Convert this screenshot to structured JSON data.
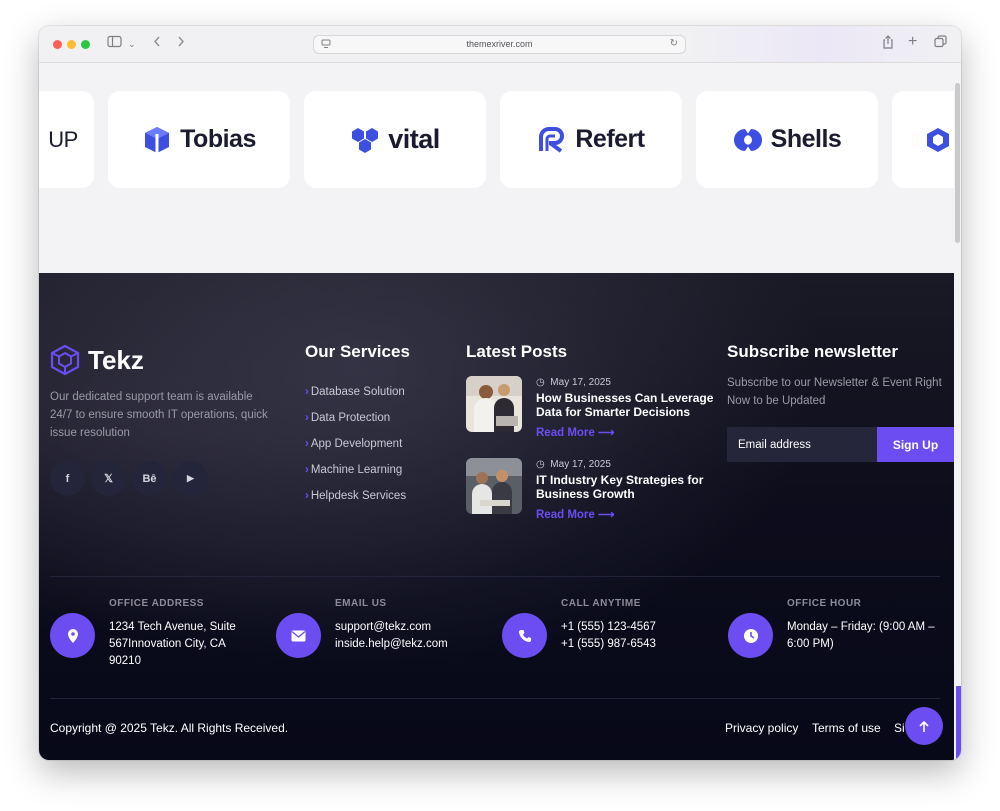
{
  "browser": {
    "url": "themexriver.com"
  },
  "logos": [
    {
      "name": "UP"
    },
    {
      "name": "Tobias"
    },
    {
      "name": "vital"
    },
    {
      "name": "Refert"
    },
    {
      "name": "Shells"
    }
  ],
  "footer": {
    "brand": {
      "name": "Tekz",
      "description": "Our dedicated support team is available 24/7 to ensure smooth IT operations, quick issue resolution"
    },
    "socials": [
      {
        "icon": "facebook-icon",
        "glyph": "f"
      },
      {
        "icon": "x-icon",
        "glyph": "𝕏"
      },
      {
        "icon": "behance-icon",
        "glyph": "Bē"
      },
      {
        "icon": "youtube-icon",
        "glyph": "▶"
      }
    ],
    "services": {
      "title": "Our Services",
      "items": [
        "Database Solution",
        "Data Protection",
        "App Development",
        "Machine Learning",
        "Helpdesk Services"
      ]
    },
    "posts": {
      "title": "Latest Posts",
      "items": [
        {
          "date": "May 17, 2025",
          "title": "How Businesses Can Leverage Data for Smarter Decisions",
          "more": "Read More"
        },
        {
          "date": "May 17, 2025",
          "title": "IT Industry Key Strategies for Business Growth",
          "more": "Read More"
        }
      ]
    },
    "newsletter": {
      "title": "Subscribe newsletter",
      "description": "Subscribe to our Newsletter & Event Right Now to be Updated",
      "placeholder": "Email address",
      "button": "Sign Up"
    },
    "contacts": [
      {
        "label": "OFFICE ADDRESS",
        "icon": "location-pin-icon",
        "lines": [
          "1234 Tech Avenue, Suite",
          "567Innovation City, CA",
          "90210"
        ]
      },
      {
        "label": "EMAIL US",
        "icon": "envelope-icon",
        "lines": [
          "support@tekz.com",
          "inside.help@tekz.com"
        ]
      },
      {
        "label": "CALL ANYTIME",
        "icon": "phone-icon",
        "lines": [
          "+1 (555) 123-4567",
          "+1 (555) 987-6543"
        ]
      },
      {
        "label": "OFFICE HOUR",
        "icon": "clock-icon",
        "lines": [
          "Monday – Friday: (9:00 AM –",
          "6:00 PM)"
        ]
      }
    ],
    "copyright": "Copyright @ 2025 Tekz. All Rights Received.",
    "legal": [
      "Privacy policy",
      "Terms of use",
      "Si"
    ]
  },
  "colors": {
    "accent": "#6c4df2",
    "footer_bg": "#070818"
  }
}
